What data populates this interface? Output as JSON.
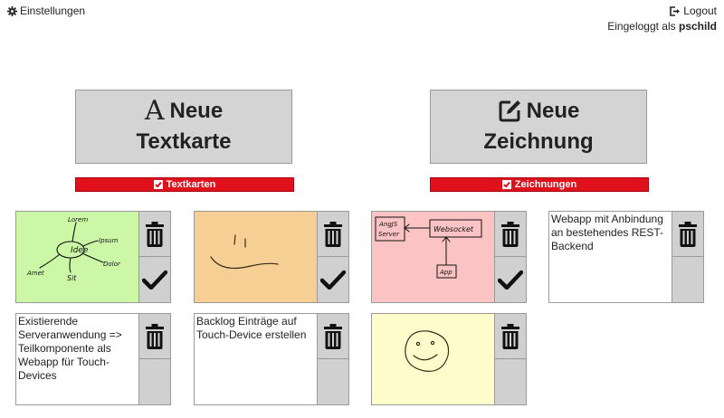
{
  "header": {
    "settings_label": "Einstellungen",
    "logout_label": "Logout",
    "logged_in_prefix": "Eingeloggt als",
    "username": "pschild"
  },
  "actions": {
    "new_text": {
      "line1": "Neue",
      "line2": "Textkarte",
      "icon": "letter-a-icon"
    },
    "new_drawing": {
      "line1": "Neue",
      "line2": "Zeichnung",
      "icon": "edit-square-icon"
    }
  },
  "filters": {
    "text": {
      "label": "Textkarten",
      "checked": true
    },
    "drawing": {
      "label": "Zeichnungen",
      "checked": true
    }
  },
  "colors": {
    "filter_bg": "#e0101c",
    "card_green": "#ccf7a6",
    "card_orange": "#f6cf94",
    "card_pink": "#fbc3c3",
    "card_yellow": "#fffccc",
    "side_panel": "#d0d0d0"
  },
  "cards": [
    {
      "type": "drawing",
      "sketch": "mindmap",
      "bg": "#ccf7a6",
      "done_button": true,
      "labels": {
        "center": "Idee",
        "a": "Lorem",
        "b": "Ipsum",
        "c": "Dolor",
        "d": "Sit",
        "e": "Amet"
      }
    },
    {
      "type": "drawing",
      "sketch": "smile",
      "bg": "#f6cf94",
      "done_button": true
    },
    {
      "type": "drawing",
      "sketch": "architecture",
      "bg": "#fbc3c3",
      "done_button": true,
      "labels": {
        "a": "AngJS",
        "a2": "Server",
        "b": "Websocket",
        "c": "App"
      }
    },
    {
      "type": "text",
      "text": "Webapp mit Anbindung an bestehendes REST-Backend",
      "done_button": false
    },
    {
      "type": "text",
      "text": "Existierende Serveranwendung => Teilkomponente als Webapp für Touch-Devices",
      "done_button": false
    },
    {
      "type": "text",
      "text": "Backlog Einträge auf Touch-Device erstellen",
      "done_button": false
    },
    {
      "type": "drawing",
      "sketch": "smiley-face",
      "bg": "#fffccc",
      "done_button": false
    }
  ]
}
